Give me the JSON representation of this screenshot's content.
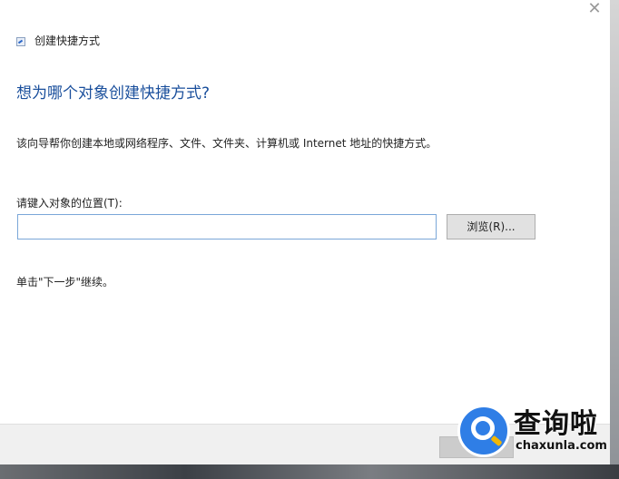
{
  "window": {
    "close_glyph": "✕",
    "title": "创建快捷方式"
  },
  "main": {
    "heading": "想为哪个对象创建快捷方式?",
    "description": "该向导帮你创建本地或网络程序、文件、文件夹、计算机或 Internet 地址的快捷方式。",
    "location_label": "请键入对象的位置(T):",
    "location_value": "",
    "browse_label": "浏览(R)...",
    "hint": "单击\"下一步\"继续。"
  },
  "watermark": {
    "brand": "查询啦",
    "domain": "chaxunla.com"
  },
  "colors": {
    "heading": "#1a4f9c",
    "input_border": "#7aa7d8",
    "watermark_blue": "#2f7ee6"
  }
}
